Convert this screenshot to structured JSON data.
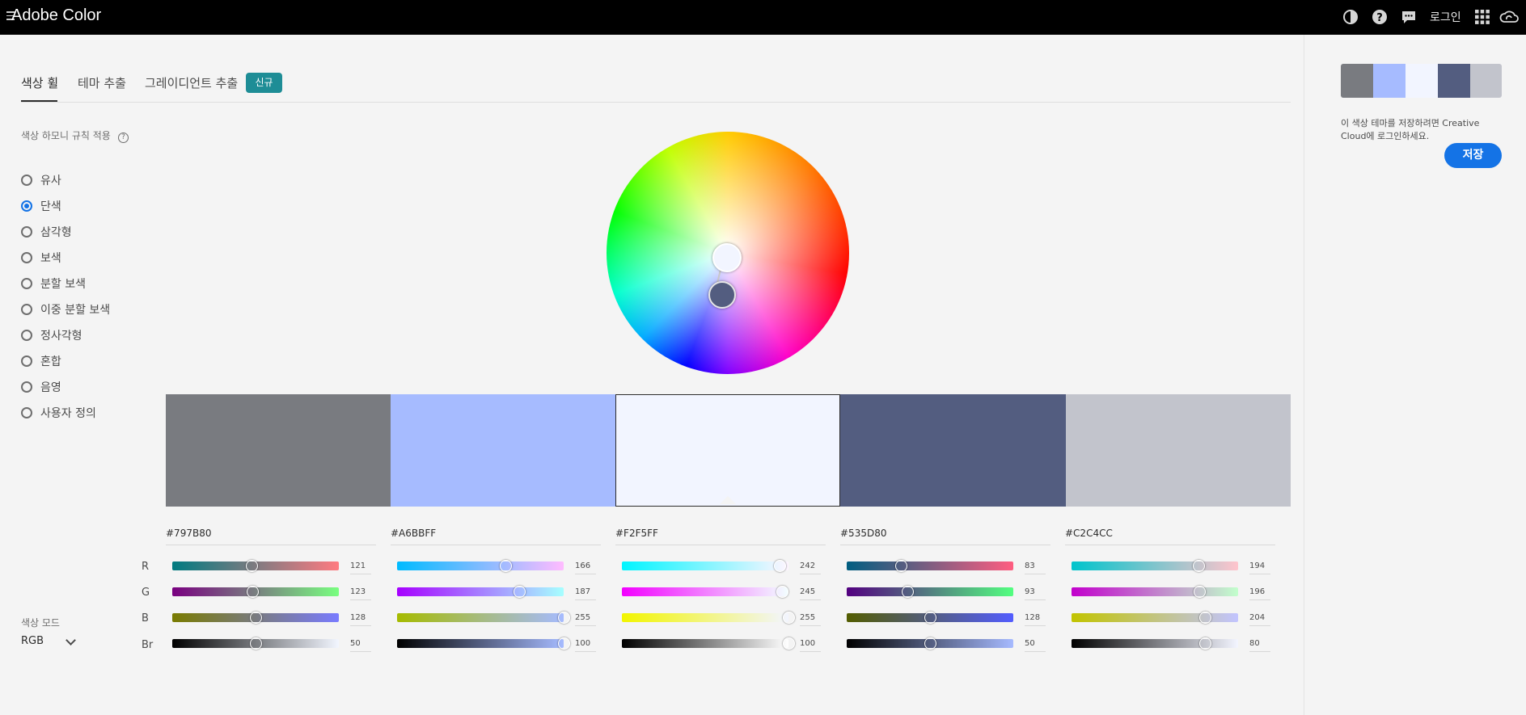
{
  "app": {
    "title": "Adobe Color",
    "login_label": "로그인",
    "icons": [
      "contrast-icon",
      "help-icon",
      "chat-icon",
      "apps-grid-icon",
      "creative-cloud-icon"
    ]
  },
  "tabs": [
    {
      "label": "색상 휠",
      "active": true
    },
    {
      "label": "테마 추출",
      "active": false
    },
    {
      "label": "그레이디언트 추출",
      "active": false
    }
  ],
  "new_badge": "신규",
  "harmony": {
    "label": "색상 하모니 규칙 적용",
    "help": "?",
    "rules": [
      "유사",
      "단색",
      "삼각형",
      "보색",
      "분할 보색",
      "이중 분할 보색",
      "정사각형",
      "혼합",
      "음영",
      "사용자 정의"
    ],
    "selected": "단색"
  },
  "color_mode": {
    "label": "색상 모드",
    "value": "RGB"
  },
  "channel_labels": [
    "R",
    "G",
    "B",
    "Br"
  ],
  "colors": [
    {
      "hex": "#797B80",
      "r": "121",
      "g": "123",
      "b": "128",
      "br": "50",
      "selected": false
    },
    {
      "hex": "#A6BBFF",
      "r": "166",
      "g": "187",
      "b": "255",
      "br": "100",
      "selected": false
    },
    {
      "hex": "#F2F5FF",
      "r": "242",
      "g": "245",
      "b": "255",
      "br": "100",
      "selected": true
    },
    {
      "hex": "#535D80",
      "r": "83",
      "g": "93",
      "b": "128",
      "br": "50",
      "selected": false
    },
    {
      "hex": "#C2C4CC",
      "r": "194",
      "g": "196",
      "b": "204",
      "br": "80",
      "selected": false
    }
  ],
  "save_panel": {
    "message": "이 색상 테마를 저장하려면 Creative Cloud에 로그인하세요.",
    "button": "저장"
  }
}
